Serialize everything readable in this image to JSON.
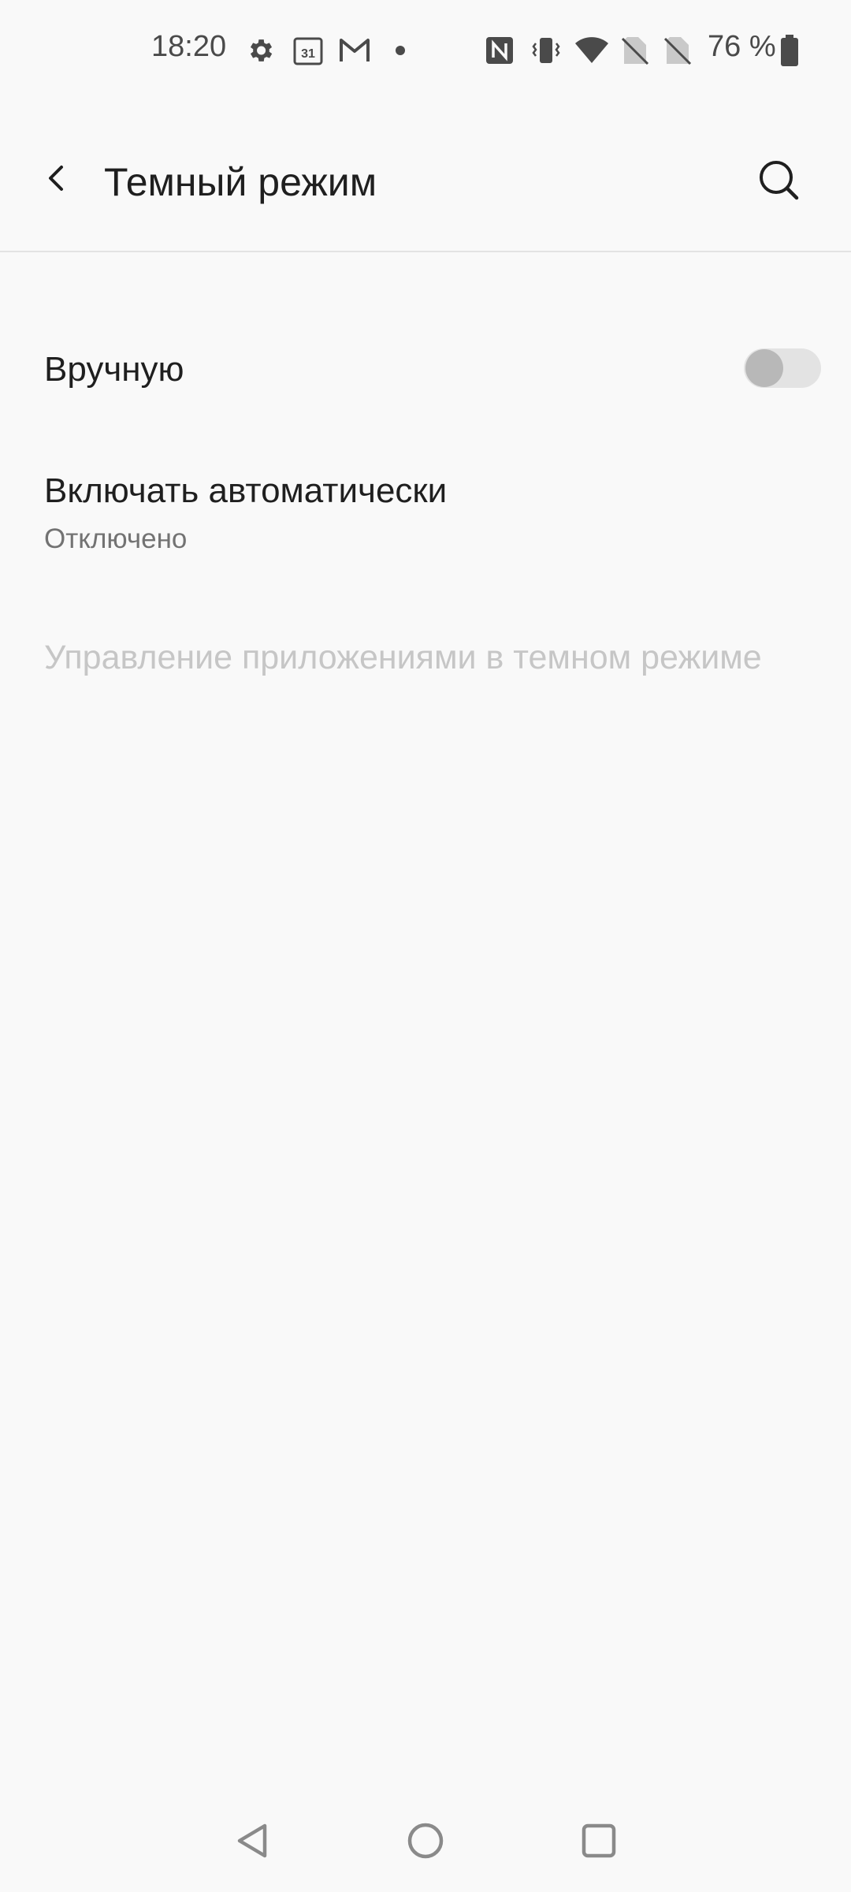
{
  "status_bar": {
    "time": "18:20",
    "calendar_day": "31",
    "battery_percent": "76 %",
    "icons": [
      "settings-icon",
      "calendar-icon",
      "gmail-icon",
      "dot-icon",
      "nfc-icon",
      "vibrate-icon",
      "wifi-icon",
      "no-sim-icon",
      "no-sim-icon",
      "battery-icon"
    ]
  },
  "app_bar": {
    "title": "Темный режим",
    "back_icon": "back-arrow-icon",
    "search_icon": "search-icon"
  },
  "settings": {
    "manual": {
      "label": "Вручную",
      "enabled": false
    },
    "auto": {
      "label": "Включать автоматически",
      "summary": "Отключено"
    },
    "apps": {
      "label": "Управление приложениями в темном режиме",
      "disabled": true
    }
  },
  "colors": {
    "background": "#f9f9f9",
    "text_primary": "#1f1f1f",
    "text_secondary": "#737373",
    "text_disabled": "#c6c6c6",
    "toggle_track": "#e3e3e3",
    "toggle_knob": "#b8b8b8"
  }
}
